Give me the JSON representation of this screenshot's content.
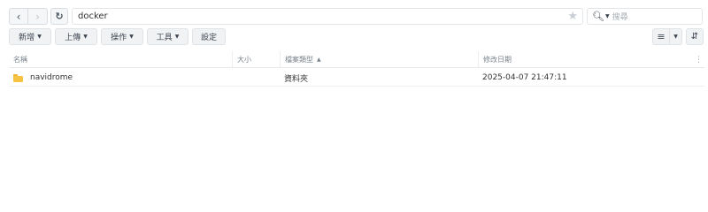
{
  "address": {
    "path": "docker",
    "search_placeholder": "搜尋"
  },
  "toolbar": {
    "buttons": [
      {
        "label": "新增"
      },
      {
        "label": "上傳"
      },
      {
        "label": "操作"
      },
      {
        "label": "工具"
      },
      {
        "label": "設定"
      }
    ]
  },
  "table": {
    "columns": {
      "name": "名稱",
      "size": "大小",
      "type": "檔案類型",
      "modified": "修改日期"
    },
    "rows": [
      {
        "name": "navidrome",
        "size": "",
        "type": "資料夾",
        "modified": "2025-04-07 21:47:11"
      }
    ]
  },
  "icons": {
    "back": "chevron-left-icon",
    "forward": "chevron-right-icon",
    "refresh": "refresh-icon",
    "favorite": "star-icon",
    "search": "search-icon",
    "list_view": "list-view-icon",
    "sort": "sort-icon",
    "folder": "folder-icon"
  },
  "colors": {
    "folder": "#f6c342",
    "button_bg": "#f0f2f4",
    "border": "#d9dde1"
  }
}
